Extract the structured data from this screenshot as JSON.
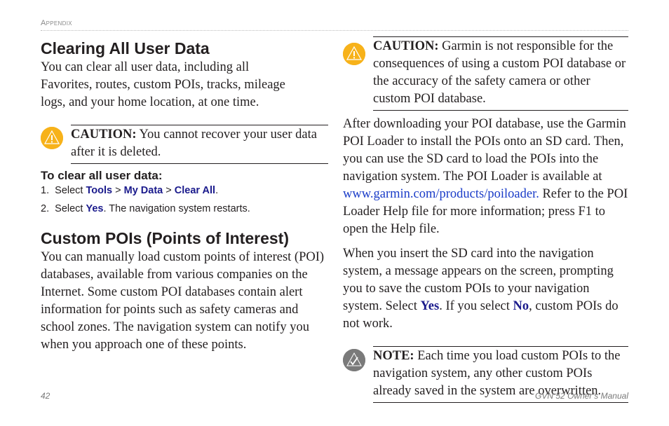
{
  "header": {
    "section": "Appendix"
  },
  "left": {
    "section1": {
      "title": "Clearing All User Data",
      "body": "You can clear all user data, including all Favorites, routes, custom POIs, tracks, mileage logs, and your home location, at one time.",
      "caution": {
        "label": "CAUTION:",
        "text": " You cannot recover your user data after it is deleted.",
        "icon": "caution-icon"
      },
      "procedure_title": "To clear all user data:",
      "steps": [
        {
          "num": "1.",
          "pre": "Select ",
          "ui1": "Tools",
          "sep1": " > ",
          "ui2": "My Data",
          "sep2": " > ",
          "ui3": "Clear All",
          "post": "."
        },
        {
          "num": "2.",
          "pre": "Select ",
          "ui1": "Yes",
          "post": ". The navigation system restarts."
        }
      ]
    },
    "section2": {
      "title": "Custom POIs (Points of Interest)",
      "body": "You can manually load custom points of interest (POI) databases, available from various companies on the Internet. Some custom POI databases contain alert information for points such as safety cameras and school zones. The navigation system can notify you when you approach one of these points."
    }
  },
  "right": {
    "caution": {
      "label": "CAUTION:",
      "text": " Garmin is not responsible for the consequences of using a custom POI database or the accuracy of the safety camera or other custom POI database.",
      "icon": "caution-icon"
    },
    "para1": {
      "pre": "After downloading your POI database, use the Garmin POI Loader to install the POIs onto an SD card. Then, you can use the SD card to load the POIs into the navigation system. The POI Loader is available at ",
      "link": "www.garmin.com/products/poiloader.",
      "post": " Refer to the POI Loader Help file for more information; press F1 to open the Help file."
    },
    "para2": {
      "pre": "When you insert the SD card into the navigation system, a message appears on the screen, prompting you to save the custom POIs to your navigation system. Select ",
      "ui1": "Yes",
      "mid": ". If you select ",
      "ui2": "No",
      "post": ", custom POIs do not work."
    },
    "note": {
      "label": "NOTE:",
      "text": " Each time you load custom POIs to the navigation system, any other custom POIs already saved in the system are overwritten.",
      "icon": "note-icon"
    }
  },
  "footer": {
    "page_number": "42",
    "manual_title": "GVN 52 Owner’s Manual"
  }
}
